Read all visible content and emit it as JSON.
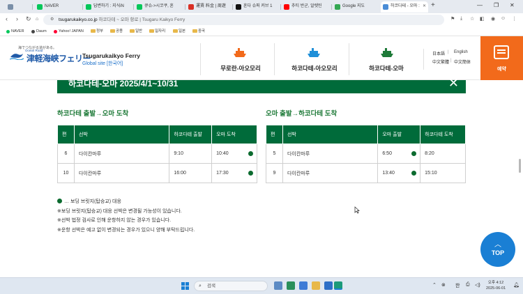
{
  "browser": {
    "tabs": [
      {
        "label": "",
        "fav_color": "#7a8fa8"
      },
      {
        "label": "NAVER",
        "fav_color": "#03c75a"
      },
      {
        "label": "답변하기 : 지식iN",
        "fav_color": "#03c75a"
      },
      {
        "label": "큐슈->시코쿠, 혼",
        "fav_color": "#03c75a"
      },
      {
        "label": "運賃·料金 | 周遊",
        "fav_color": "#d93025"
      },
      {
        "label": "혼다 슈퍼 커브 1",
        "fav_color": "#111111"
      },
      {
        "label": "추티 반군, 알렛틴",
        "fav_color": "#ff0000"
      },
      {
        "label": "Google 지도",
        "fav_color": "#34a853"
      },
      {
        "label": "하코다테 - 오마 :",
        "fav_color": "#4a8cd6"
      }
    ],
    "active_tab_index": 8,
    "url_host": "tsugarukaikyo.co.jp",
    "url_rest": "  하코다테 ~ 오마 항로 | Tsugaru Kaikyo Ferry",
    "bookmarks": [
      {
        "label": "NAVER",
        "kind": "dot",
        "color": "#03c75a"
      },
      {
        "label": "Daum",
        "kind": "dot",
        "color": "#444444"
      },
      {
        "label": "Yahoo! JAPAN",
        "kind": "dot",
        "color": "#ff0033"
      },
      {
        "label": "정부",
        "kind": "folder"
      },
      {
        "label": "공용",
        "kind": "folder"
      },
      {
        "label": "일반",
        "kind": "folder"
      },
      {
        "label": "일자리",
        "kind": "folder"
      },
      {
        "label": "일본",
        "kind": "folder"
      },
      {
        "label": "중국",
        "kind": "folder"
      }
    ]
  },
  "header": {
    "logo_tagline": "海でつながる道がある。",
    "logo_small": "Ocean Road",
    "logo_text": "津軽海峡フェリー",
    "brand_title": "Tsugarukaikyo Ferry",
    "brand_sub": "Global site [한국어]",
    "routes": [
      {
        "label": "무로란-아오모리",
        "color": "#f26a1b"
      },
      {
        "label": "하코다테-아오모리",
        "color": "#1f8fd8"
      },
      {
        "label": "하코다테-오마",
        "color": "#1e7a38"
      }
    ],
    "lang": {
      "ja": "日本語",
      "en": "English",
      "zh_tw": "中文繁體",
      "zh_cn": "中文簡体"
    },
    "reserve_label": "예약"
  },
  "content": {
    "banner_title": "하코다테-오마  2025/4/1~10/31",
    "left_title": "하코다테 출발→오마 도착",
    "right_title": "오마 출발→하코다테 도착",
    "left_headers": [
      "편",
      "선박",
      "하코다테 출발",
      "오마 도착"
    ],
    "right_headers": [
      "편",
      "선박",
      "오마 출발",
      "하코다테 도착"
    ],
    "left_rows": [
      {
        "no": "6",
        "ship": "다이칸마루",
        "dep": "9:10",
        "arr": "10:40"
      },
      {
        "no": "10",
        "ship": "다이칸마루",
        "dep": "16:00",
        "arr": "17:30"
      }
    ],
    "right_rows": [
      {
        "no": "5",
        "ship": "다이칸마루",
        "dep": "6:50",
        "arr": "8:20"
      },
      {
        "no": "9",
        "ship": "다이칸마루",
        "dep": "13:40",
        "arr": "15:10"
      }
    ],
    "notes": [
      "… 보딩 브릿지(탑승교) 대응",
      "※보딩 브릿지(탑승교) 대응 선박은 변경될 가능성이 있습니다.",
      "※선박 법정 검사로 인해 운항하지 않는 경우가 있습니다.",
      "※운항 선박은 예고 없이 변경되는 경우가 있으니 양해 부탁드립니다."
    ],
    "top_button": "TOP",
    "dot_color": "#0c6b2f"
  },
  "taskbar": {
    "search_placeholder": "검색",
    "ime": "한",
    "time": "오후 4:12",
    "date": "2025-06-01"
  }
}
